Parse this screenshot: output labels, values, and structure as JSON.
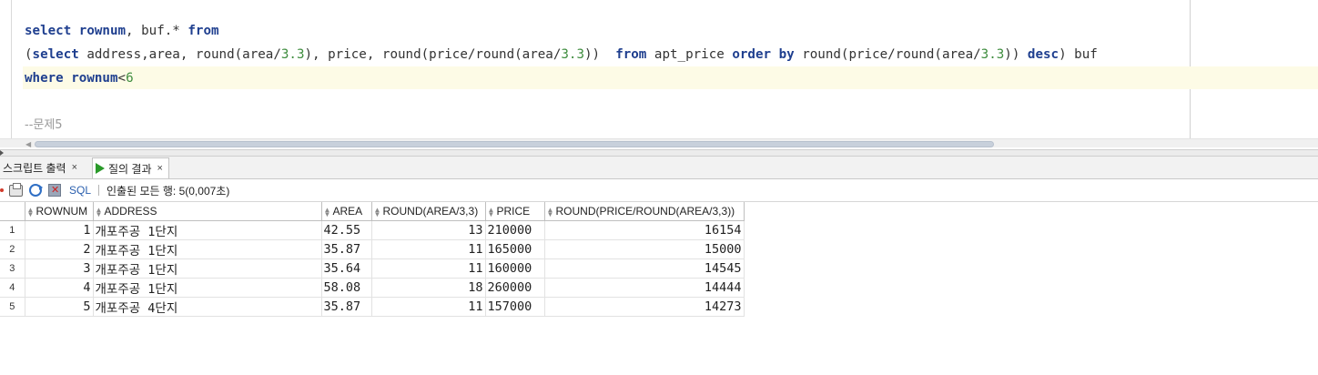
{
  "editor": {
    "line1": {
      "kw1": "select",
      "kw2": "rownum",
      "t1": ", buf.* ",
      "kw3": "from"
    },
    "line2": {
      "p1": "(",
      "kw1": "select",
      "t1": " address,area, round(area/",
      "n1": "3.3",
      "t2": "), price, round(price/round(area/",
      "n2": "3.3",
      "t3": "))  ",
      "kw2": "from",
      "t4": " apt_price ",
      "kw3": "order by",
      "t5": " round(price/round(area/",
      "n3": "3.3",
      "t6": ")) ",
      "kw4": "desc",
      "t7": ") buf"
    },
    "line3": {
      "kw1": "where",
      "t1": " ",
      "kw2": "rownum",
      "t2": "<",
      "n1": "6"
    },
    "comment": "--문제5"
  },
  "tabs": {
    "script_output": "스크립트 출력",
    "query_result": "질의 결과",
    "close": "×"
  },
  "toolbar": {
    "sql_label": "SQL",
    "status": "인출된 모든 행: 5(0,007초)"
  },
  "grid": {
    "columns": [
      "ROWNUM",
      "ADDRESS",
      "AREA",
      "ROUND(AREA/3,3)",
      "PRICE",
      "ROUND(PRICE/ROUND(AREA/3,3))"
    ],
    "rows": [
      {
        "n": "1",
        "rownum": "1",
        "address": "개포주공 1단지",
        "area": "42.55",
        "round_area": "13",
        "price": "210000",
        "ppa": "16154"
      },
      {
        "n": "2",
        "rownum": "2",
        "address": "개포주공 1단지",
        "area": "35.87",
        "round_area": "11",
        "price": "165000",
        "ppa": "15000"
      },
      {
        "n": "3",
        "rownum": "3",
        "address": "개포주공 1단지",
        "area": "35.64",
        "round_area": "11",
        "price": "160000",
        "ppa": "14545"
      },
      {
        "n": "4",
        "rownum": "4",
        "address": "개포주공 1단지",
        "area": "58.08",
        "round_area": "18",
        "price": "260000",
        "ppa": "14444"
      },
      {
        "n": "5",
        "rownum": "5",
        "address": "개포주공 4단지",
        "area": "35.87",
        "round_area": "11",
        "price": "157000",
        "ppa": "14273"
      }
    ]
  }
}
